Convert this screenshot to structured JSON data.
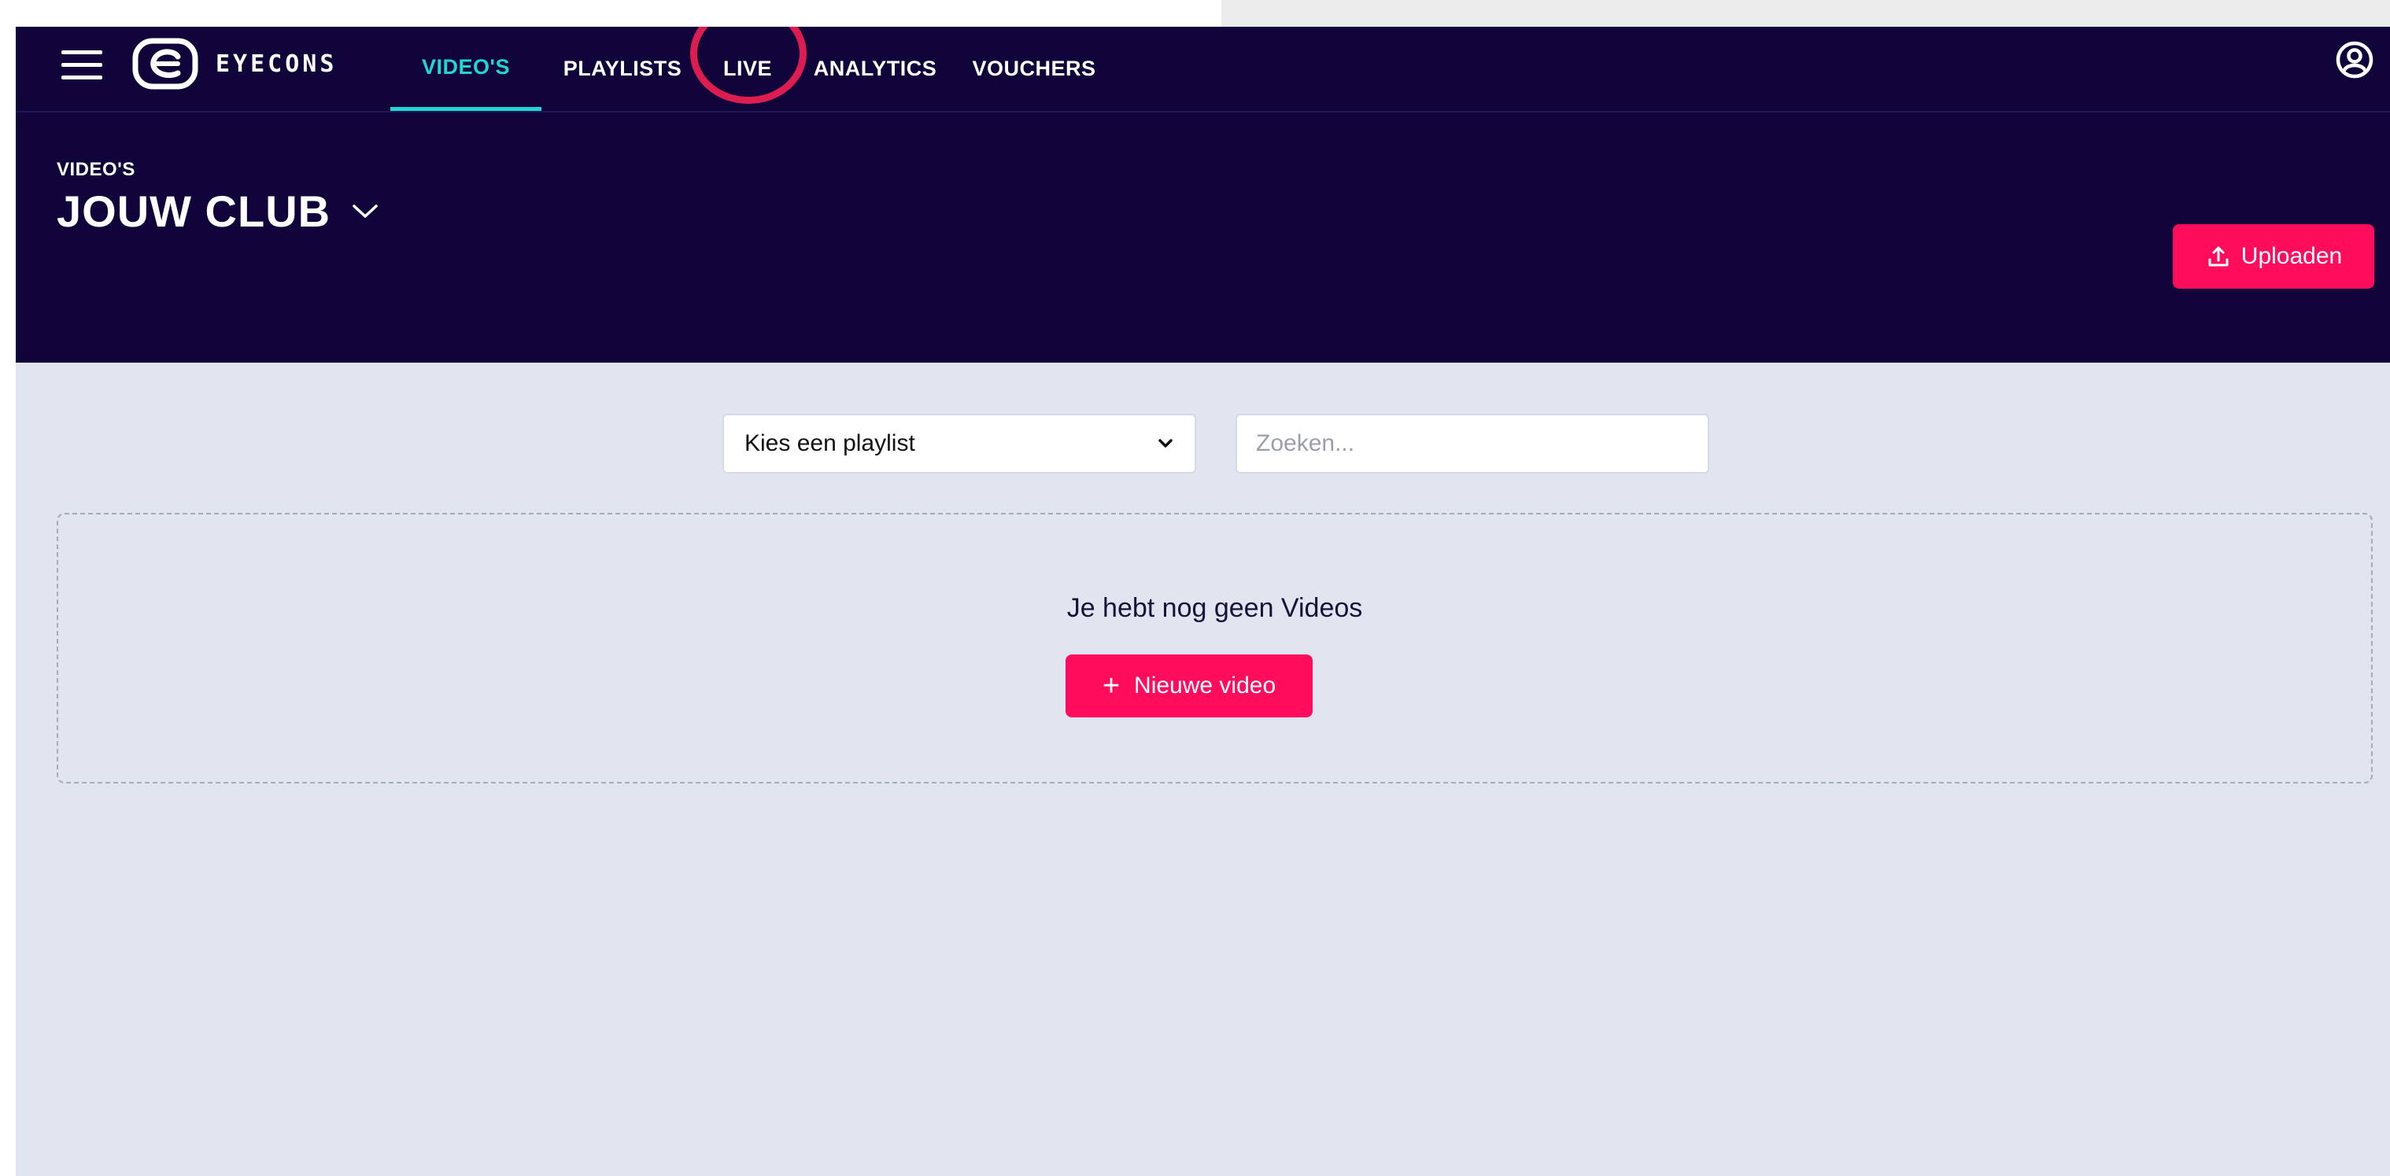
{
  "nav": {
    "brand": "EYECONS",
    "tabs": [
      {
        "label": "VIDEO'S",
        "active": true
      },
      {
        "label": "PLAYLISTS",
        "active": false
      },
      {
        "label": "LIVE",
        "active": false,
        "highlighted": true
      },
      {
        "label": "ANALYTICS",
        "active": false
      },
      {
        "label": "VOUCHERS",
        "active": false
      }
    ],
    "menu_icon": "hamburger-menu-icon",
    "profile_icon": "user-profile-icon"
  },
  "header": {
    "section_label": "VIDEO'S",
    "club_name": "JOUW CLUB",
    "upload_label": "Uploaden",
    "upload_icon": "upload-icon"
  },
  "filters": {
    "playlist_selected": "Kies een playlist",
    "search_placeholder": "Zoeken..."
  },
  "empty_state": {
    "message": "Je hebt nog geen Videos",
    "button_label": "Nieuwe video",
    "button_icon": "plus-icon"
  },
  "colors": {
    "navy": "#10043a",
    "accent_teal": "#1ed7d0",
    "accent_pink": "#ff0c5d",
    "highlight_ring": "#dd1d4f",
    "background": "#e1e5f0"
  }
}
